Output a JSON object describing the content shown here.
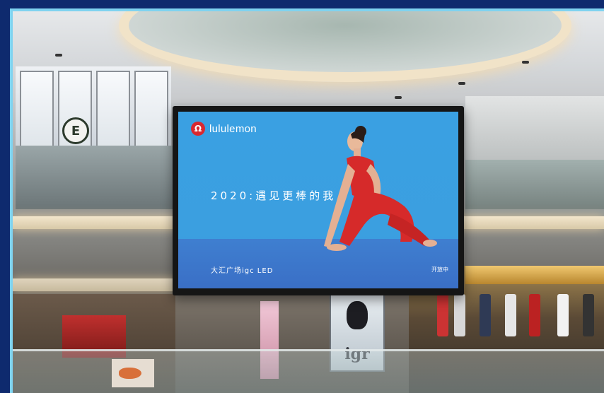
{
  "colors": {
    "frame": "#0e2a6e",
    "frame_border": "#7fd3f0",
    "screen_blue": "#3aa0e2",
    "bodysuit_red": "#d62a2a",
    "brand_red": "#d9282f"
  },
  "mall": {
    "store_badge": "E",
    "poster_text": "igr"
  },
  "screen": {
    "brand_logo_glyph": "Ω",
    "brand_name": "lululemon",
    "slogan": "2020:遇见更棒的我",
    "footer_left": "大汇广场igc LED",
    "footer_right": "开放中"
  },
  "icons": {
    "brand_logo": "lululemon-logo-icon"
  }
}
